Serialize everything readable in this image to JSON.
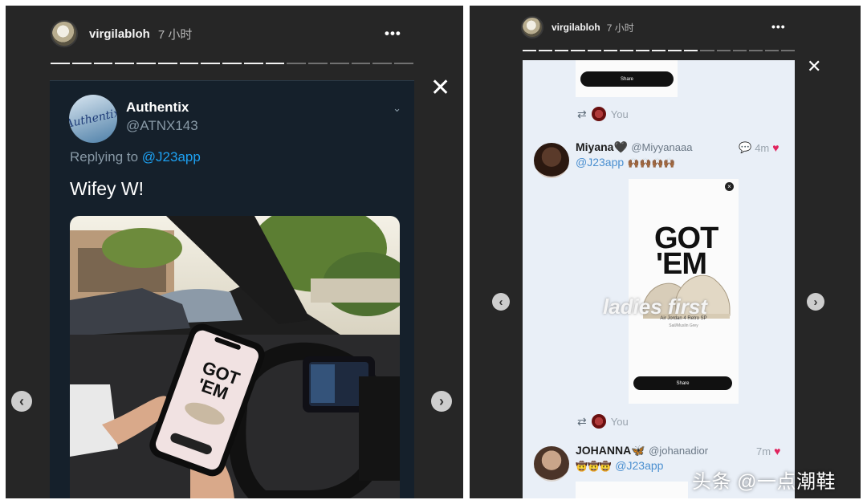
{
  "left_story": {
    "username": "virgilabloh",
    "time": "7 小时",
    "more_icon": "•••",
    "close_icon": "✕",
    "progress": {
      "total": 17,
      "completed": 11
    },
    "nav": {
      "prev": "‹",
      "next": "›"
    },
    "tweet": {
      "name": "Authentix",
      "handle": "@ATNX143",
      "avatar_text": "Authentix",
      "chevron": "⌄",
      "reply_prefix": "Replying to",
      "reply_mention": "@J23app",
      "text": "Wifey W!",
      "phone_text_line1": "GOT",
      "phone_text_line2": "'EM"
    }
  },
  "right_story": {
    "username": "virgilabloh",
    "time": "7 小时",
    "more_icon": "•••",
    "close_icon": "✕",
    "progress": {
      "total": 17,
      "completed": 11
    },
    "nav": {
      "prev": "‹",
      "next": "›"
    },
    "top_share_label": "Share",
    "top_you": "You",
    "dm1": {
      "name": "Miyana🖤",
      "handle": "@Miyyanaaa",
      "time": "4m",
      "mention": "@J23app",
      "emojis": "🙌🏾🙌🏾🙌🏾🙌🏾",
      "card_text_line1": "GOT",
      "card_text_line2": "'EM",
      "overlay_text": "ladies first",
      "product_name": "Air Jordan 4 Retro SP",
      "product_sub": "Sail/Muslin Grey",
      "share_label": "Share",
      "you": "You"
    },
    "dm2": {
      "name": "JOHANNA🦋",
      "handle": "@johanadior",
      "time": "7m",
      "emojis": "🤠🤠🤠",
      "mention": "@J23app"
    }
  },
  "watermark": "头条 @一点潮鞋"
}
